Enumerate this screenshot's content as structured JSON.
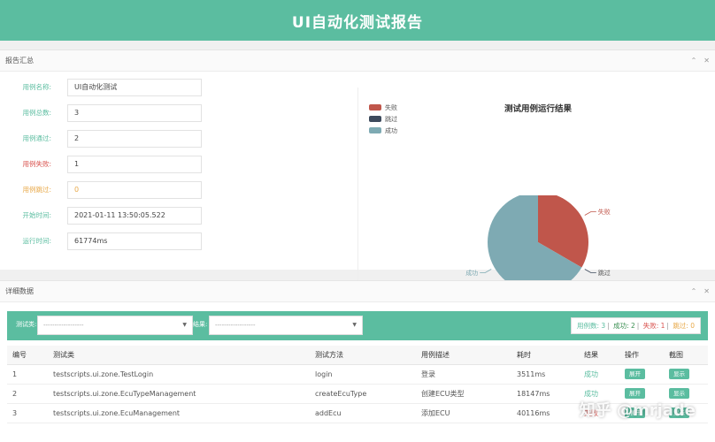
{
  "header": {
    "title": "UI自动化测试报告"
  },
  "summary": {
    "title": "报告汇总",
    "tools": {
      "collapse": "⌃",
      "close": "✕"
    },
    "fields": [
      {
        "label": "用例名称:",
        "value": "UI自动化测试"
      },
      {
        "label": "用例总数:",
        "value": "3"
      },
      {
        "label": "用例通过:",
        "value": "2"
      },
      {
        "label": "用例失败:",
        "value": "1"
      },
      {
        "label": "用例跳过:",
        "value": "0"
      },
      {
        "label": "开始时间:",
        "value": "2021-01-11 13:50:05.522"
      },
      {
        "label": "运行时间:",
        "value": "61774ms"
      }
    ],
    "colors": {
      "fail": "#c0564b",
      "skip": "#3d4a5c",
      "pass": "#7eaab3"
    }
  },
  "chart_data": {
    "type": "pie",
    "title": "测试用例运行结果",
    "legend": [
      "失败",
      "跳过",
      "成功"
    ],
    "legend_position": "top-left",
    "slices": [
      {
        "name": "失败",
        "value": 1
      },
      {
        "name": "跳过",
        "value": 0
      },
      {
        "name": "成功",
        "value": 2
      }
    ]
  },
  "details": {
    "title": "详细数据",
    "tools": {
      "collapse": "⌃",
      "close": "✕"
    },
    "filter_class_label": "测试类:",
    "filter_class_placeholder": "------------------",
    "filter_result_label": "结果:",
    "filter_result_placeholder": "------------------",
    "stats": {
      "total": "用例数: 3",
      "pass": "成功: 2",
      "fail": "失败: 1",
      "skip": "跳过: 0"
    },
    "columns": [
      "编号",
      "测试类",
      "测试方法",
      "用例描述",
      "耗时",
      "结果",
      "操作",
      "截图"
    ],
    "rows": [
      {
        "id": "1",
        "cls": "testscripts.ui.zone.TestLogin",
        "method": "login",
        "desc": "登录",
        "time": "3511ms",
        "result": "成功",
        "op": "展开",
        "shot": "显示"
      },
      {
        "id": "2",
        "cls": "testscripts.ui.zone.EcuTypeManagement",
        "method": "createEcuType",
        "desc": "创建ECU类型",
        "time": "18147ms",
        "result": "成功",
        "op": "展开",
        "shot": "显示"
      },
      {
        "id": "3",
        "cls": "testscripts.ui.zone.EcuManagement",
        "method": "addEcu",
        "desc": "添加ECU",
        "time": "40116ms",
        "result": "失败",
        "op": "展开",
        "shot": "显示"
      }
    ]
  },
  "watermark": "知乎 @mrjade"
}
